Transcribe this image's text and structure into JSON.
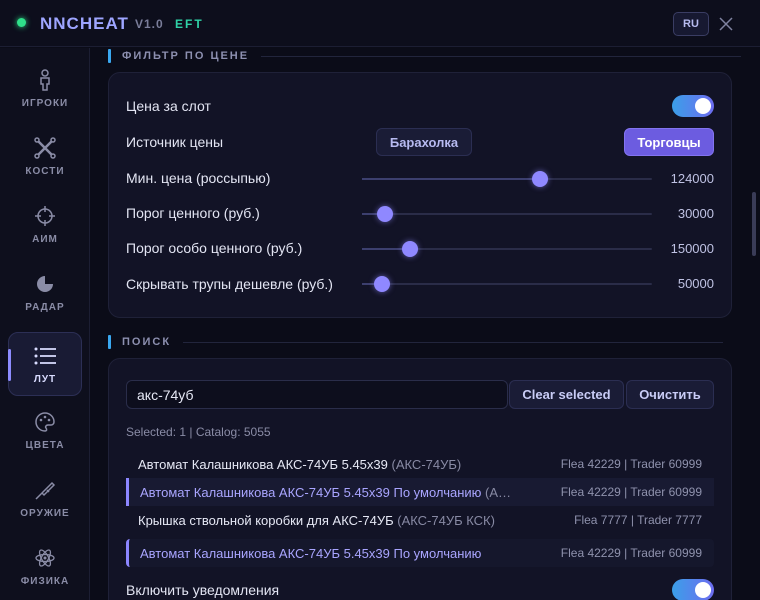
{
  "titlebar": {
    "app_name": "NNCHEAT",
    "version": "V1.0",
    "game": "EFT",
    "lang_button": "RU",
    "status_color": "#2fe08a"
  },
  "sidebar": {
    "items": [
      {
        "label": "ИГРОКИ",
        "icon": "person-icon"
      },
      {
        "label": "КОСТИ",
        "icon": "bones-icon"
      },
      {
        "label": "АИМ",
        "icon": "crosshair-icon"
      },
      {
        "label": "РАДАР",
        "icon": "radar-icon"
      },
      {
        "label": "ЛУТ",
        "icon": "list-icon",
        "active": true
      },
      {
        "label": "ЦВЕТА",
        "icon": "palette-icon"
      },
      {
        "label": "ОРУЖИЕ",
        "icon": "rifle-icon"
      },
      {
        "label": "ФИЗИКА",
        "icon": "atom-icon"
      }
    ]
  },
  "price_filter": {
    "section_title": "ФИЛЬТР ПО ЦЕНЕ",
    "price_per_slot_label": "Цена за слот",
    "price_per_slot_enabled": true,
    "price_source_label": "Источник цены",
    "source_flea": "Барахолка",
    "source_traders": "Торговцы",
    "source_selected": "Торговцы",
    "sliders": [
      {
        "label": "Мин. цена (россыпью)",
        "value": "124000",
        "fraction": 0.615
      },
      {
        "label": "Порог ценного (руб.)",
        "value": "30000",
        "fraction": 0.08
      },
      {
        "label": "Порог особо ценного (руб.)",
        "value": "150000",
        "fraction": 0.165
      },
      {
        "label": "Скрывать трупы дешевле (руб.)",
        "value": "50000",
        "fraction": 0.07
      }
    ]
  },
  "search": {
    "section_title": "ПОИСК",
    "query": "акс-74уб",
    "clear_selected": "Clear selected",
    "clear": "Очистить",
    "stats": "Selected: 1 | Catalog: 5055",
    "results": [
      {
        "name": "Автомат Калашникова АКС-74УБ 5.45x39",
        "alias": "(АКС-74УБ)",
        "price": "Flea 42229 | Trader 60999",
        "selected": false
      },
      {
        "name": "Автомат Калашникова АКС-74УБ 5.45x39 По умолчанию",
        "alias": "(А…",
        "price": "Flea 42229 | Trader 60999",
        "selected": true
      },
      {
        "name": "Крышка ствольной коробки для АКС-74УБ",
        "alias": "(АКС-74УБ КСК)",
        "price": "Flea 7777 | Trader 7777",
        "selected": false
      }
    ],
    "selected_item": {
      "name": "Автомат Калашникова АКС-74УБ 5.45x39 По умолчанию",
      "price": "Flea 42229 | Trader 60999"
    },
    "notify_label": "Включить уведомления",
    "notify_enabled": true
  }
}
